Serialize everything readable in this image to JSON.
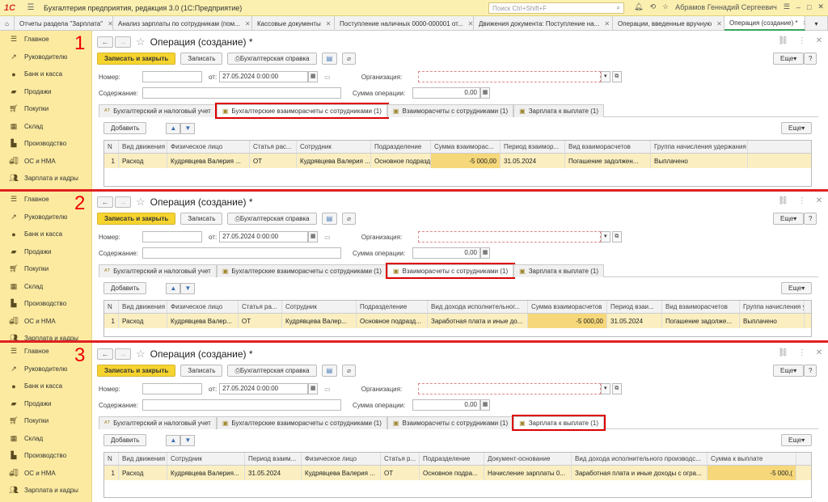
{
  "titlebar": {
    "app_title": "Бухгалтерия предприятия, редакция 3.0  (1С:Предприятие)",
    "search_placeholder": "Поиск Ctrl+Shift+F",
    "user": "Абрамов Геннадий Сергеевич"
  },
  "tabs": [
    {
      "label": "Отчеты раздела \"Зарплата\""
    },
    {
      "label": "Анализ зарплаты по сотрудникам (пом..."
    },
    {
      "label": "Кассовые документы"
    },
    {
      "label": "Поступление наличных 0000-000001 от..."
    },
    {
      "label": "Движения документа: Поступление на..."
    },
    {
      "label": "Операции, введенные вручную"
    },
    {
      "label": "Операция (создание) *"
    }
  ],
  "sidebar": {
    "items": [
      {
        "label": "Главное",
        "icon": "menu-icon"
      },
      {
        "label": "Руководителю",
        "icon": "chart-icon"
      },
      {
        "label": "Банк и касса",
        "icon": "coin-icon"
      },
      {
        "label": "Продажи",
        "icon": "bag-icon"
      },
      {
        "label": "Покупки",
        "icon": "cart-icon"
      },
      {
        "label": "Склад",
        "icon": "warehouse-icon"
      },
      {
        "label": "Производство",
        "icon": "factory-icon"
      },
      {
        "label": "ОС и НМА",
        "icon": "truck-icon"
      },
      {
        "label": "Зарплата и кадры",
        "icon": "people-icon"
      }
    ]
  },
  "form": {
    "title": "Операция (создание) *",
    "btn_save_close": "Записать и закрыть",
    "btn_save": "Записать",
    "btn_report": "Бухгалтерская справка",
    "btn_more": "Еще",
    "btn_help": "?",
    "lbl_number": "Номер:",
    "lbl_from": "от:",
    "date": "27.05.2024  0:00:00",
    "lbl_org": "Организация:",
    "lbl_content": "Содержание:",
    "lbl_sum": "Сумма операции:",
    "sum": "0,00",
    "btn_add": "Добавить"
  },
  "ftabs": [
    {
      "label": "Бухгалтерский и налоговый учет"
    },
    {
      "label": "Бухгалтерские взаиморасчеты с сотрудниками (1)"
    },
    {
      "label": "Взаиморасчеты с сотрудниками (1)"
    },
    {
      "label": "Зарплата к выплате (1)"
    }
  ],
  "panels": [
    {
      "num": "1",
      "headers": [
        "N",
        "Вид движения",
        "Физическое лицо",
        "Статья рас...",
        "Сотрудник",
        "Подразделение",
        "Сумма взаиморас...",
        "Период взаимор...",
        "Вид взаиморасчетов",
        "Группа начисления удержания выплаты"
      ],
      "row": [
        "1",
        "Расход",
        "Кудрявцева Валерия ...",
        "ОТ",
        "Кудрявцева Валерия ...",
        "Основное подразде...",
        "-5 000,00",
        "31.05.2024",
        "Погашение задолжен...",
        "Выплачено"
      ]
    },
    {
      "num": "2",
      "headers": [
        "N",
        "Вид движения",
        "Физическое лицо",
        "Статья ра...",
        "Сотрудник",
        "Подразделение",
        "Вид дохода исполнительног...",
        "Сумма взаиморасчетов",
        "Период взаи...",
        "Вид взаиморасчетов",
        "Группа начисления уд"
      ],
      "row": [
        "1",
        "Расход",
        "Кудрявцева Валер...",
        "ОТ",
        "Кудрявцева Валер...",
        "Основное подразд...",
        "Заработная плата и иные до...",
        "-5 000,00",
        "31.05.2024",
        "Погашение задолже...",
        "Выплачено"
      ]
    },
    {
      "num": "3",
      "headers": [
        "N",
        "Вид движения",
        "Сотрудник",
        "Период взаим...",
        "Физическое лицо",
        "Статья р...",
        "Подразделение",
        "Документ-основание",
        "Вид дохода исполнительного производс...",
        "Сумма к выплате"
      ],
      "row": [
        "1",
        "Расход",
        "Кудрявцева Валерия...",
        "31.05.2024",
        "Кудрявцева Валерия ...",
        "ОТ",
        "Основное подра...",
        "Начисление зарплаты 0...",
        "Заработная плата и иные доходы с огра...",
        "-5 000,("
      ]
    }
  ]
}
